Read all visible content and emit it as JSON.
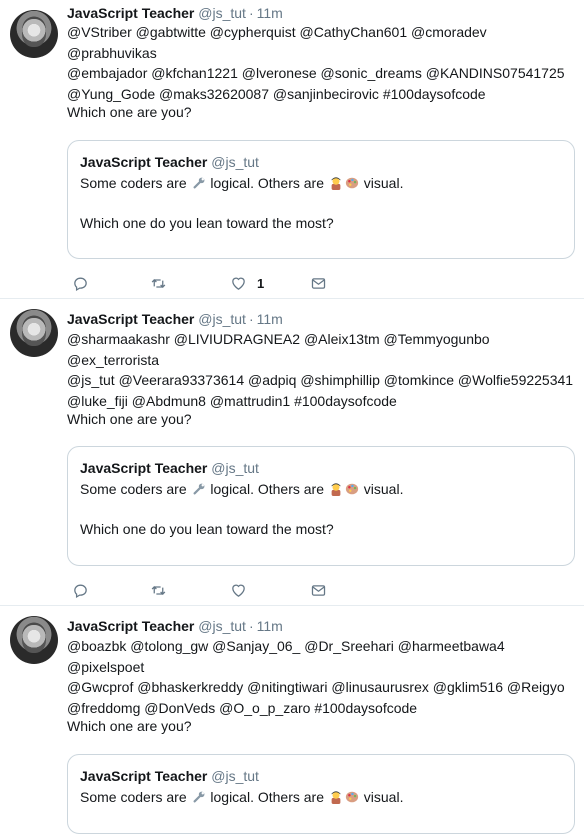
{
  "tweets": [
    {
      "name": "JavaScript Teacher",
      "handle": "@js_tut",
      "dot": "·",
      "time": "11m",
      "lines": [
        "@VStriber @gabtwitte @cypherquist @CathyChan601 @cmoradev @prabhuvikas",
        "@embajador @kfchan1221 @lveronese @sonic_dreams @KANDINS07541725",
        "@Yung_Gode @maks32620087 @sanjinbecirovic #100daysofcode"
      ],
      "question": "Which one are you?",
      "quote": {
        "name": "JavaScript Teacher",
        "handle": "@js_tut",
        "line1_a": "Some coders are",
        "line1_b": "logical. Others are",
        "line1_c": "visual.",
        "line2": "Which one do you lean toward the most?"
      },
      "like_count": "1"
    },
    {
      "name": "JavaScript Teacher",
      "handle": "@js_tut",
      "dot": "·",
      "time": "11m",
      "lines": [
        "@sharmaakashr @LIVIUDRAGNEA2 @Aleix13tm @Temmyogunbo @ex_terrorista",
        "@js_tut @Veerara93373614 @adpiq @shimphillip @tomkince @Wolfie59225341",
        "@luke_fiji @Abdmun8 @mattrudin1 #100daysofcode"
      ],
      "question": "Which one are you?",
      "quote": {
        "name": "JavaScript Teacher",
        "handle": "@js_tut",
        "line1_a": "Some coders are",
        "line1_b": "logical. Others are",
        "line1_c": "visual.",
        "line2": "Which one do you lean toward the most?"
      },
      "like_count": ""
    },
    {
      "name": "JavaScript Teacher",
      "handle": "@js_tut",
      "dot": "·",
      "time": "11m",
      "lines": [
        "@boazbk @tolong_gw @Sanjay_06_ @Dr_Sreehari @harmeetbawa4 @pixelspoet",
        "@Gwcprof @bhaskerkreddy @nitingtiwari @linusaurusrex @gklim516 @Reigyo",
        "@freddomg @DonVeds @O_o_p_zaro #100daysofcode"
      ],
      "question": "Which one are you?",
      "quote": {
        "name": "JavaScript Teacher",
        "handle": "@js_tut",
        "line1_a": "Some coders are",
        "line1_b": "logical. Others are",
        "line1_c": "visual.",
        "line2": ""
      },
      "like_count": ""
    }
  ],
  "icons": {
    "reply": "reply-icon",
    "retweet": "retweet-icon",
    "like": "heart-icon",
    "message": "envelope-icon",
    "wrench": "wrench-emoji-icon",
    "teacher": "teacher-emoji-icon",
    "palette": "palette-emoji-icon"
  },
  "colors": {
    "text": "#14171a",
    "secondary": "#657786",
    "border": "#e6ecf0",
    "quote_border": "#ccd6dd"
  }
}
